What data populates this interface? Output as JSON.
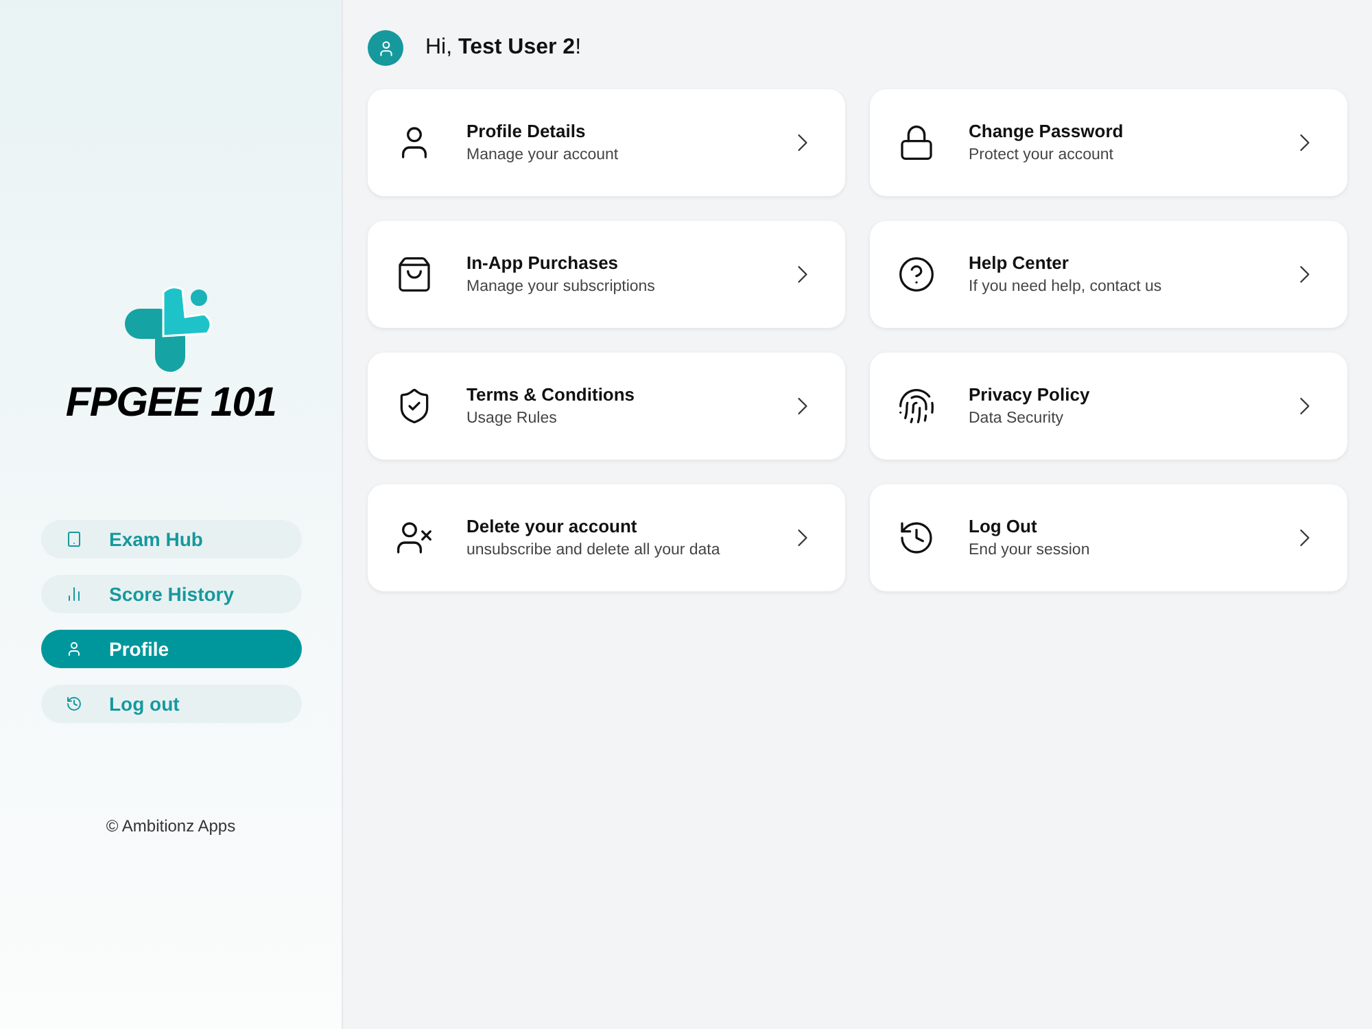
{
  "sidebar": {
    "logo_text": "FPGEE 101",
    "nav": [
      {
        "kind": "exam",
        "label": "Exam Hub",
        "selected": false
      },
      {
        "kind": "score",
        "label": "Score History",
        "selected": false
      },
      {
        "kind": "profile",
        "label": "Profile",
        "selected": true
      },
      {
        "kind": "logout",
        "label": "Log out",
        "selected": false
      }
    ],
    "footer": "© Ambitionz Apps"
  },
  "greeting": "Hi, **Test User 2**!",
  "cards": [
    {
      "kind": "profile",
      "title": "Profile Details",
      "subtitle": "Manage your account"
    },
    {
      "kind": "lock",
      "title": "Change Password",
      "subtitle": "Protect your account"
    },
    {
      "kind": "bag",
      "title": "In-App Purchases",
      "subtitle": "Manage your subscriptions"
    },
    {
      "kind": "help",
      "title": "Help Center",
      "subtitle": "If you need help, contact us"
    },
    {
      "kind": "shield",
      "title": "Terms & Conditions",
      "subtitle": "Usage Rules"
    },
    {
      "kind": "fingerprint",
      "title": "Privacy Policy",
      "subtitle": "Data Security"
    },
    {
      "kind": "delete",
      "title": "Delete your account",
      "subtitle": "unsubscribe and delete all your data"
    },
    {
      "kind": "logout",
      "title": "Log Out",
      "subtitle": "End your session"
    }
  ]
}
